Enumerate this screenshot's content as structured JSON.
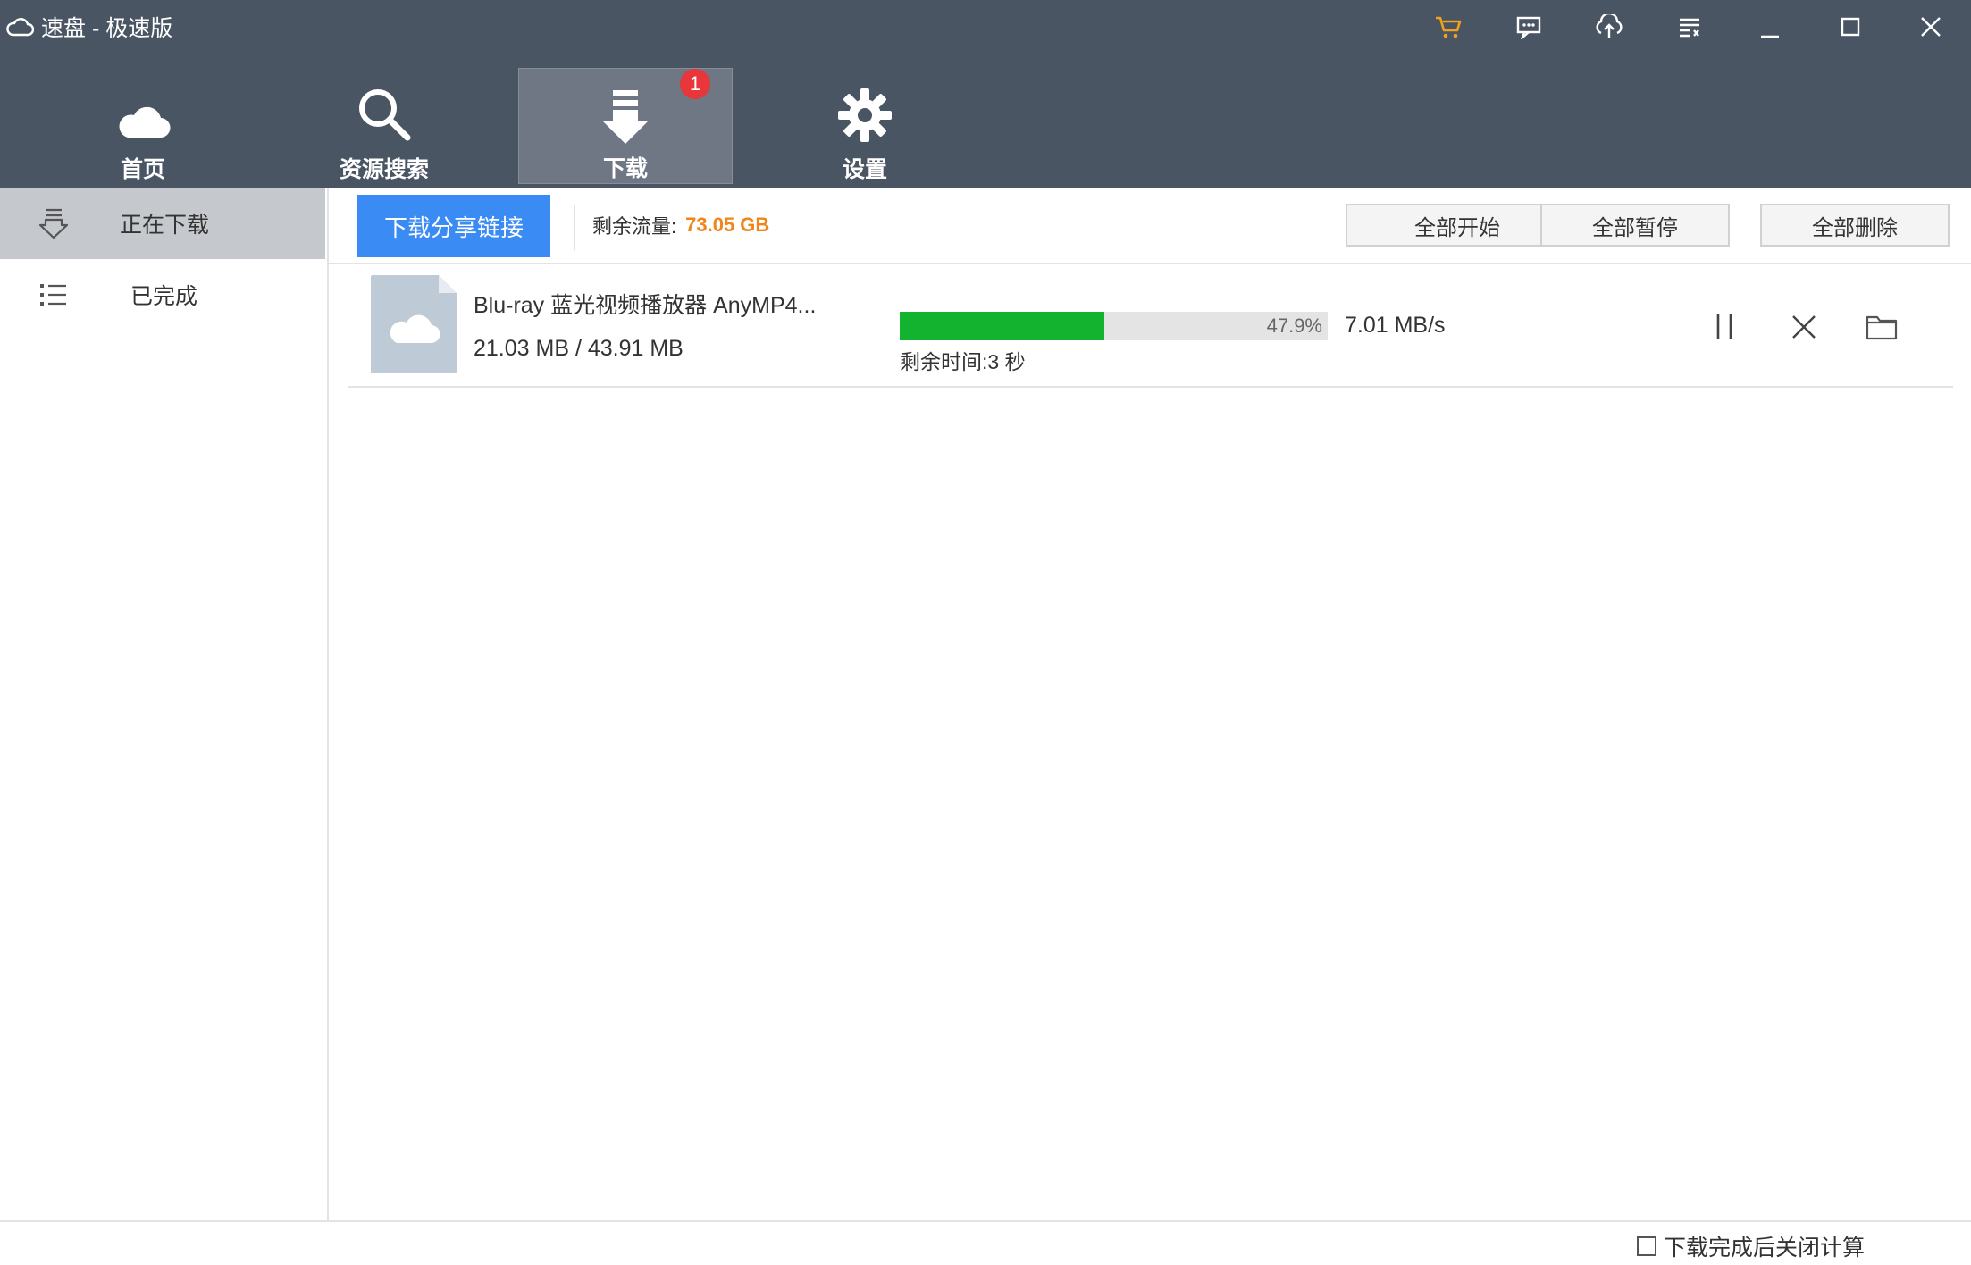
{
  "window": {
    "title": "速盘 - 极速版",
    "controls": [
      "cart-icon",
      "message-icon",
      "upload-icon",
      "menu-icon",
      "minimize-icon",
      "maximize-icon",
      "close-icon"
    ],
    "accent_color": "#f0a21b"
  },
  "nav": {
    "items": [
      {
        "label": "首页",
        "icon": "cloud-icon"
      },
      {
        "label": "资源搜索",
        "icon": "search-icon"
      },
      {
        "label": "下载",
        "icon": "download-icon",
        "badge": "1",
        "active": true
      },
      {
        "label": "设置",
        "icon": "gear-icon"
      }
    ]
  },
  "sidebar": {
    "items": [
      {
        "label": "正在下载",
        "icon": "downloading-icon",
        "active": true
      },
      {
        "label": "已完成",
        "icon": "list-icon"
      }
    ]
  },
  "toolbar": {
    "share_link_label": "下载分享链接",
    "quota_label": "剩余流量:",
    "quota_value": "73.05 GB",
    "start_all_label": "全部开始",
    "pause_all_label": "全部暂停",
    "delete_all_label": "全部删除"
  },
  "downloads": [
    {
      "name": "Blu-ray 蓝光视频播放器 AnyMP4...",
      "size": "21.03 MB / 43.91 MB",
      "progress_text": "47.9%",
      "progress": 0.479,
      "remaining": "剩余时间:3 秒",
      "speed": "7.01 MB/s",
      "actions": [
        "pause-icon",
        "cancel-icon",
        "folder-icon"
      ]
    }
  ],
  "footer": {
    "shutdown_label": "下载完成后关闭计算",
    "shutdown_checked": false
  },
  "colors": {
    "titlebar": "#4a5563",
    "primary_button": "#3b8bf5",
    "progress": "#14b32f",
    "quota_value": "#f08519",
    "badge": "#e8363a"
  }
}
